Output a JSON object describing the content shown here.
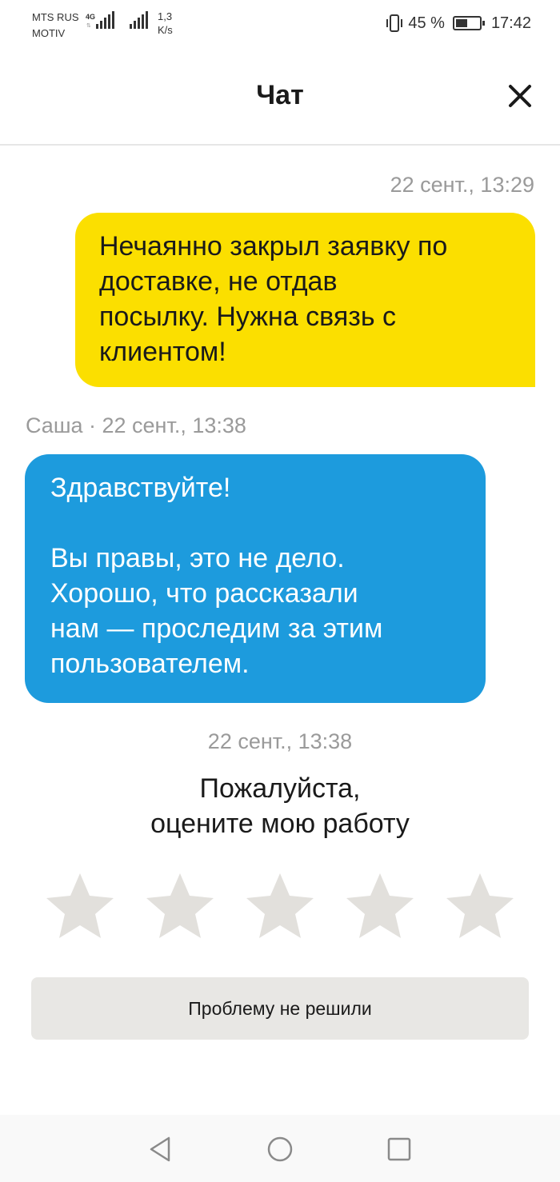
{
  "status_bar": {
    "carrier_line1": "MTS RUS",
    "carrier_line2": "MOTIV",
    "network_type": "4G",
    "speed_value": "1,3",
    "speed_unit": "K/s",
    "battery_percent": "45 %",
    "time": "17:42"
  },
  "header": {
    "title": "Чат",
    "close_icon": "close-icon"
  },
  "messages": [
    {
      "direction": "outgoing",
      "timestamp": "22 сент., 13:29",
      "lines": [
        "Нечаянно закрыл заявку по",
        "доставке, не отдав",
        "посылку. Нужна связь с",
        "клиентом!"
      ]
    },
    {
      "direction": "incoming",
      "sender_and_time": "Саша · 22 сент., 13:38",
      "paragraph1": "Здравствуйте!",
      "lines": [
        "Вы правы, это не дело.",
        "Хорошо, что рассказали",
        "нам — проследим за этим",
        "пользователем."
      ]
    }
  ],
  "rating": {
    "timestamp": "22 сент., 13:38",
    "title_line1": "Пожалуйста,",
    "title_line2": "оцените мою работу",
    "star_count": 5,
    "selected_stars": 0,
    "star_color": "#e2e0dc"
  },
  "unsolved_button": {
    "label": "Проблему не решили"
  },
  "nav_bar": {
    "icons": [
      "back-icon",
      "home-icon",
      "recents-icon"
    ]
  },
  "colors": {
    "outgoing_bubble": "#fbdf00",
    "incoming_bubble": "#1d9bdd",
    "timestamp": "#9a9a9a"
  }
}
